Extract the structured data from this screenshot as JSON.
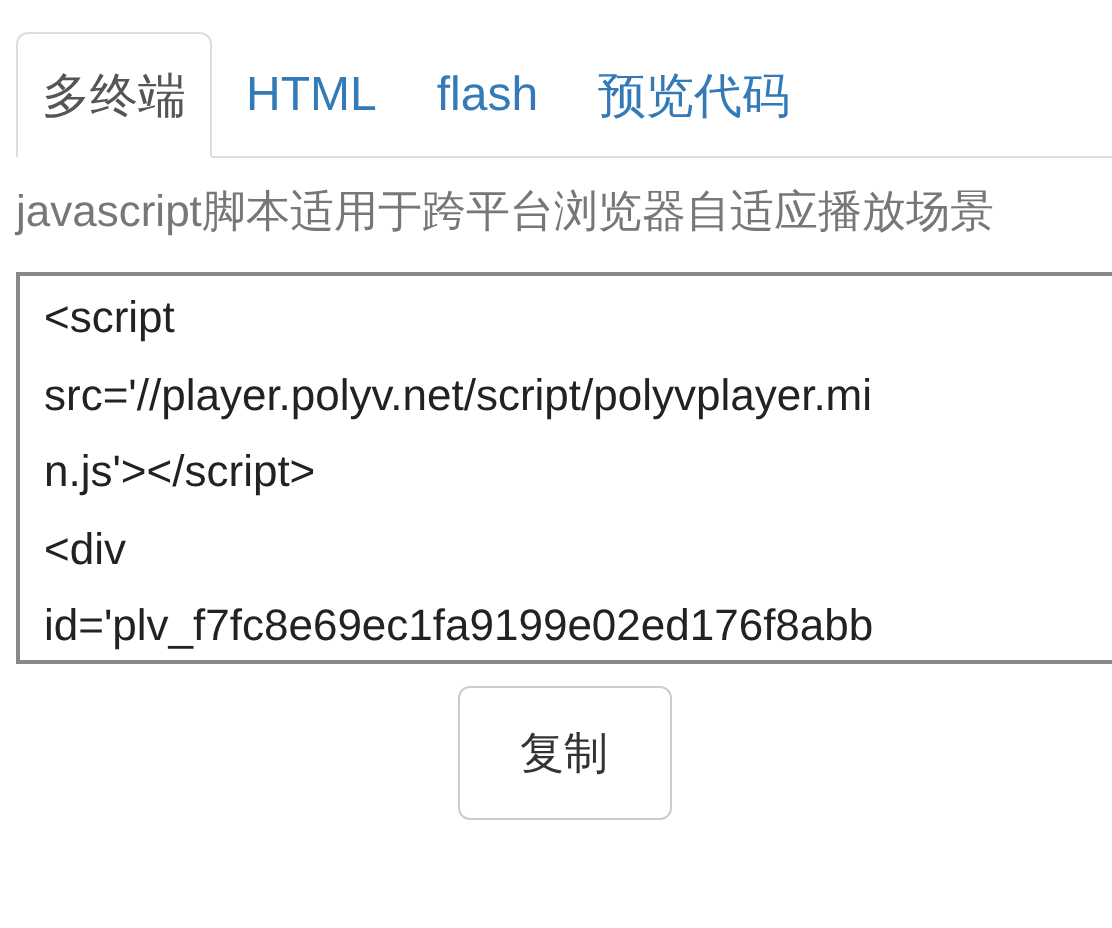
{
  "tabs": [
    {
      "label": "多终端",
      "selected": true
    },
    {
      "label": "HTML",
      "selected": false
    },
    {
      "label": "flash",
      "selected": false
    },
    {
      "label": "预览代码",
      "selected": false
    }
  ],
  "description": "javascript脚本适用于跨平台浏览器自适应播放场景",
  "code_lines": [
    "<script",
    "src='//player.polyv.net/script/polyvplayer.mi",
    "n.js'></script>",
    "<div",
    "id='plv_f7fc8e69ec1fa9199e02ed176f8abb"
  ],
  "copy_button": "复制"
}
